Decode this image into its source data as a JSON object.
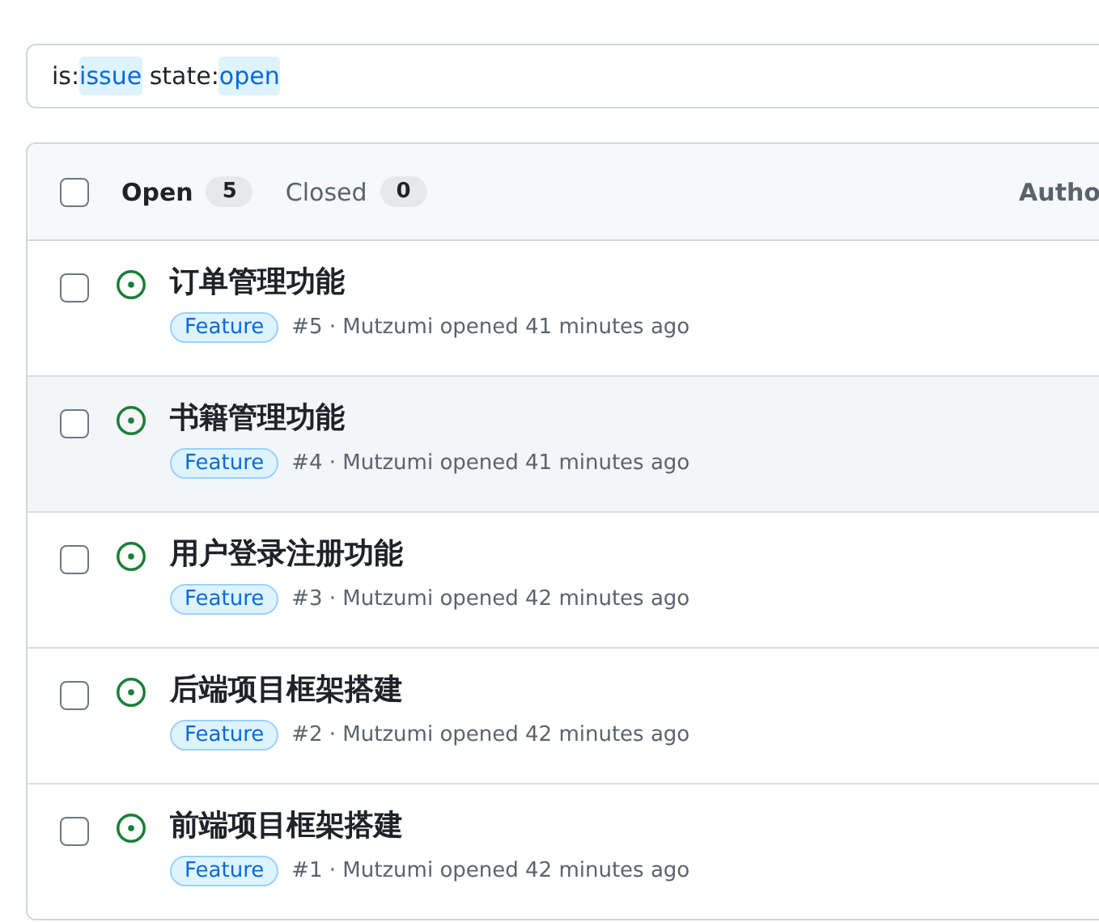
{
  "search": {
    "tokens": [
      {
        "text": "is:",
        "kind": "key"
      },
      {
        "text": "issue",
        "kind": "value"
      },
      {
        "text": " state:",
        "kind": "key"
      },
      {
        "text": "open",
        "kind": "value"
      }
    ]
  },
  "header": {
    "checked": false,
    "tabs": [
      {
        "label": "Open",
        "count": "5",
        "selected": true
      },
      {
        "label": "Closed",
        "count": "0",
        "selected": false
      }
    ],
    "column_3": "Autho"
  },
  "issues": [
    {
      "title": "订单管理功能",
      "label": "Feature",
      "meta": "#5 · Mutzumi opened 41 minutes ago",
      "checked": false,
      "hovered": false
    },
    {
      "title": "书籍管理功能",
      "label": "Feature",
      "meta": "#4 · Mutzumi opened 41 minutes ago",
      "checked": false,
      "hovered": true
    },
    {
      "title": "用户登录注册功能",
      "label": "Feature",
      "meta": "#3 · Mutzumi opened 42 minutes ago",
      "checked": false,
      "hovered": false
    },
    {
      "title": "后端项目框架搭建",
      "label": "Feature",
      "meta": "#2 · Mutzumi opened 42 minutes ago",
      "checked": false,
      "hovered": false
    },
    {
      "title": "前端项目框架搭建",
      "label": "Feature",
      "meta": "#1 · Mutzumi opened 42 minutes ago",
      "checked": false,
      "hovered": false
    }
  ]
}
